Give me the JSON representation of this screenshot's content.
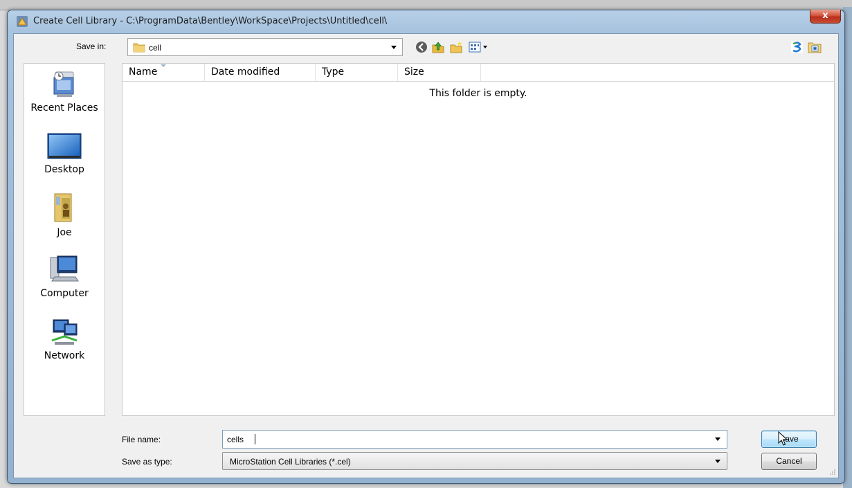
{
  "window": {
    "title": "Create Cell Library - C:\\ProgramData\\Bentley\\WorkSpace\\Projects\\Untitled\\cell\\",
    "close_label": "x"
  },
  "toolbar": {
    "save_in_label": "Save in:",
    "save_in_value": "cell"
  },
  "places": [
    {
      "label": "Recent Places",
      "icon": "recent-places-icon"
    },
    {
      "label": "Desktop",
      "icon": "desktop-icon"
    },
    {
      "label": "Joe",
      "icon": "user-folder-icon"
    },
    {
      "label": "Computer",
      "icon": "computer-icon"
    },
    {
      "label": "Network",
      "icon": "network-icon"
    }
  ],
  "file_list": {
    "columns": [
      "Name",
      "Date modified",
      "Type",
      "Size"
    ],
    "empty_message": "This folder is empty."
  },
  "fields": {
    "file_name_label": "File name:",
    "file_name_value": "cells",
    "save_as_type_label": "Save as type:",
    "save_as_type_value": "MicroStation Cell Libraries (*.cel)"
  },
  "buttons": {
    "save": "Save",
    "cancel": "Cancel"
  },
  "colors": {
    "title_bar": "#a7c3de",
    "close_button": "#c84c35",
    "primary_button": "#bee6fd"
  }
}
